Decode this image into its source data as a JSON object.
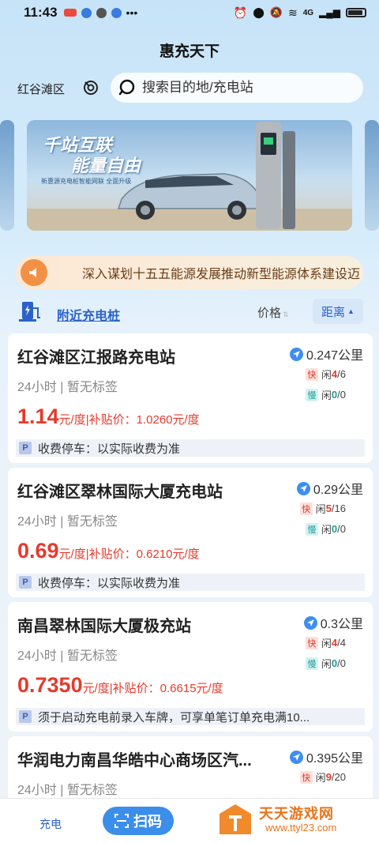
{
  "status_bar": {
    "time": "11:43",
    "network": "4G"
  },
  "header": {
    "title": "惠充天下"
  },
  "location": {
    "name": "红谷滩区"
  },
  "search": {
    "placeholder": "搜索目的地/充电站"
  },
  "banner": {
    "slogan_line1": "千站互联",
    "slogan_line2": "能量自由",
    "subtitle": "新惠源充电桩智能网联 全面升级"
  },
  "notice": {
    "text": "深入谋划十五五能源发展推动新型能源体系建设迈"
  },
  "filter": {
    "nearby_label": "附近充电桩",
    "sort_price": "价格",
    "sort_distance": "距离"
  },
  "stations": [
    {
      "name": "红谷滩区江报路充电站",
      "distance": "0.247公里",
      "hours": "24小时 | 暂无标签",
      "price": "1.14",
      "price_unit": "元/度|补贴价：1.0260元/度",
      "fast_label": "快",
      "fast_idle_label": "闲",
      "fast_free": "4",
      "fast_total": "/6",
      "slow_label": "慢",
      "slow_idle_label": "闲",
      "slow_free": "0",
      "slow_total": "/0",
      "parking": "收费停车：以实际收费为准"
    },
    {
      "name": "红谷滩区翠林国际大厦充电站",
      "distance": "0.29公里",
      "hours": "24小时 | 暂无标签",
      "price": "0.69",
      "price_unit": "元/度|补贴价：0.6210元/度",
      "fast_label": "快",
      "fast_idle_label": "闲",
      "fast_free": "5",
      "fast_total": "/16",
      "slow_label": "慢",
      "slow_idle_label": "闲",
      "slow_free": "0",
      "slow_total": "/0",
      "parking": "收费停车：以实际收费为准"
    },
    {
      "name": "南昌翠林国际大厦极充站",
      "distance": "0.3公里",
      "hours": "24小时 | 暂无标签",
      "price": "0.7350",
      "price_unit": "元/度|补贴价：0.6615元/度",
      "fast_label": "快",
      "fast_idle_label": "闲",
      "fast_free": "4",
      "fast_total": "/4",
      "slow_label": "慢",
      "slow_idle_label": "闲",
      "slow_free": "0",
      "slow_total": "/0",
      "parking": "须于启动充电前录入车牌，可享单笔订单充电满10..."
    },
    {
      "name": "华润电力南昌华皓中心商场区汽...",
      "distance": "0.395公里",
      "hours": "24小时 | 暂无标签",
      "fast_label": "快",
      "fast_idle_label": "闲",
      "fast_free": "9",
      "fast_total": "/20"
    }
  ],
  "bottom_nav": {
    "charge_tab": "充电",
    "scan_button": "扫码"
  },
  "watermark": {
    "title": "天天游戏网",
    "url": "www.ttyl23.com"
  },
  "colors": {
    "accent": "#3b8ee9",
    "price": "#e53a2c",
    "fast": "#e53a2c",
    "slow": "#1b9e96",
    "notice_bg": "#fde8d4"
  }
}
